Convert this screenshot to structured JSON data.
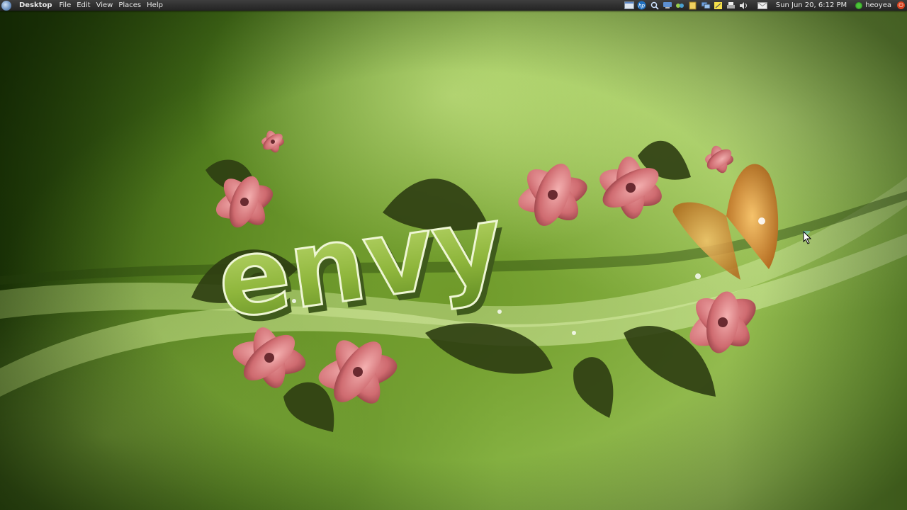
{
  "panel": {
    "menus": [
      "Desktop",
      "File",
      "Edit",
      "View",
      "Places",
      "Help"
    ],
    "clock": "Sun Jun 20,  6:12 PM",
    "username": "heoyea",
    "tray_icons": [
      "window-list-icon",
      "hp-icon",
      "search-icon",
      "network-icon",
      "note-icon",
      "notification-icon",
      "display-icon",
      "notes-icon",
      "printer-icon",
      "volume-icon",
      "mail-icon"
    ]
  },
  "wallpaper": {
    "text": "envy"
  },
  "colors": {
    "panel_bg": "#2e2e2e",
    "panel_text": "#e6e6e6",
    "status_online": "#4cc43a",
    "power_red": "#d8421e"
  }
}
